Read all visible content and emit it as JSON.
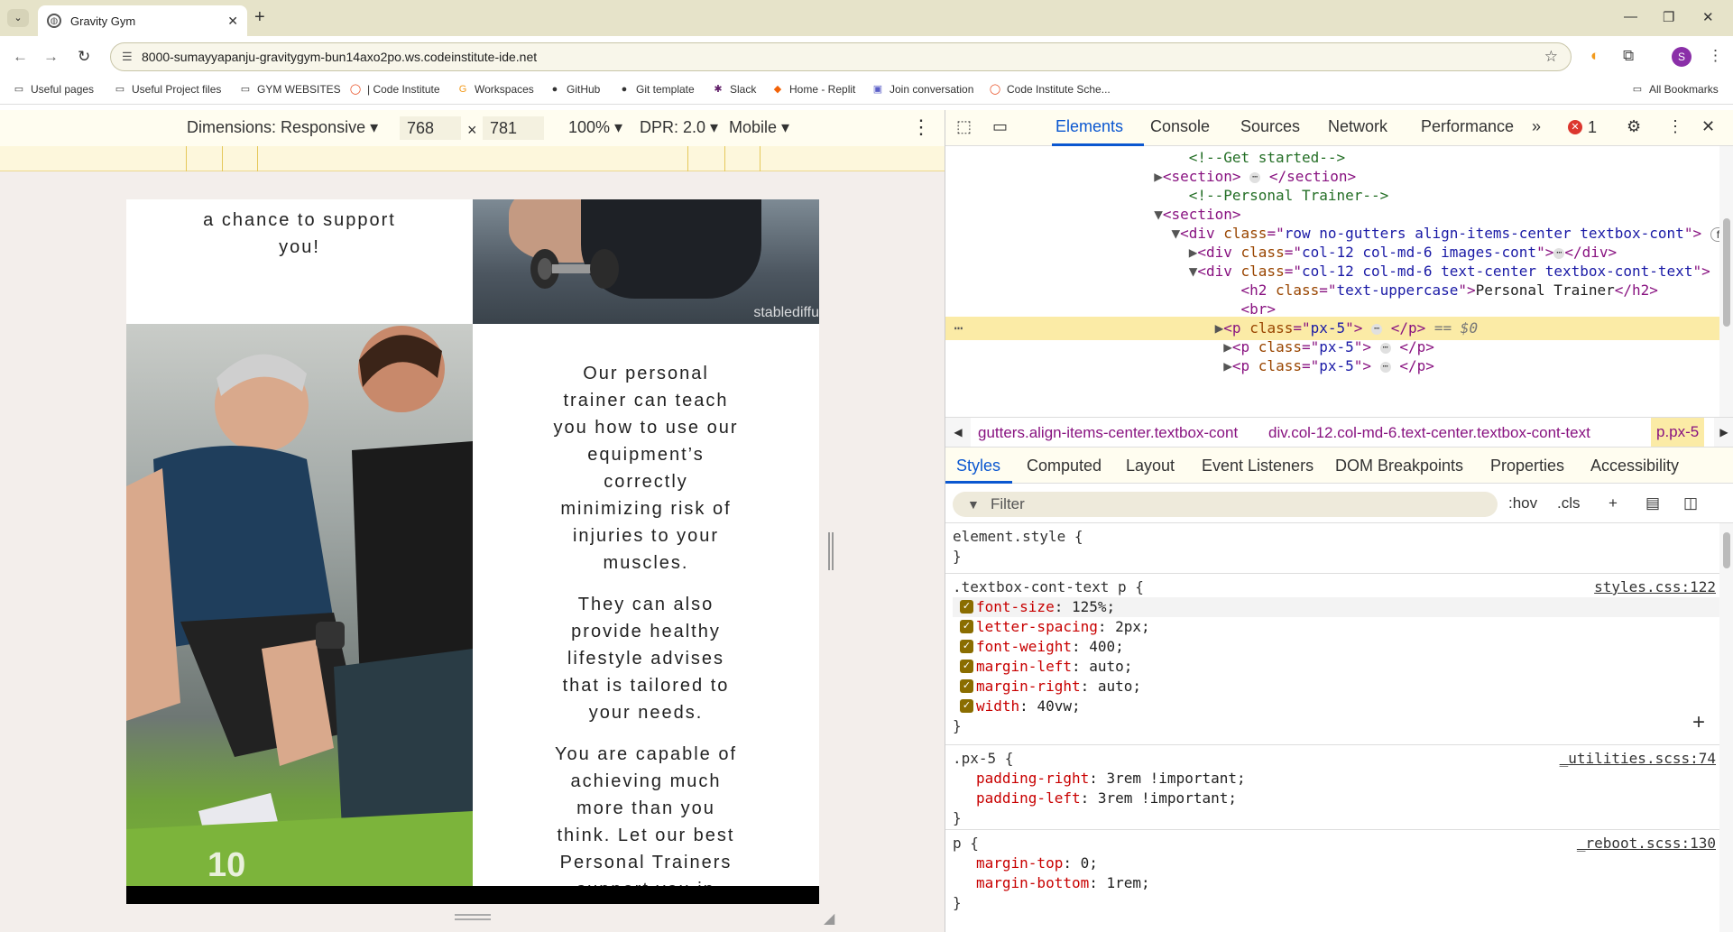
{
  "browser": {
    "tab_title": "Gravity Gym",
    "url": "8000-sumayyapanju-gravitygym-bun14axo2po.ws.codeinstitute-ide.net",
    "avatar_letter": "S",
    "bookmarks": [
      "Useful pages",
      "Useful Project files",
      "GYM WEBSITES",
      "| Code Institute",
      "Workspaces",
      "GitHub",
      "Git template",
      "Slack",
      "Home - Replit",
      "Join conversation",
      "Code Institute Sche..."
    ],
    "all_bookmarks": "All Bookmarks"
  },
  "device_toolbar": {
    "dimensions_label": "Dimensions: Responsive",
    "width": "768",
    "height": "781",
    "times": "×",
    "zoom": "100%",
    "dpr": "DPR: 2.0",
    "device_type": "Mobile"
  },
  "page": {
    "top_text_l1": "a chance to support",
    "top_text_l2": "you!",
    "watermark": "stablediffu",
    "para1": "Our personal trainer can teach you how to use our equipment’s correctly minimizing risk of injuries to your muscles.",
    "para2": "They can also provide healthy lifestyle advises that is tailored to your needs.",
    "para3": "You are capable of achieving much more than you think. Let our best Personal Trainers support you in this!"
  },
  "devtools": {
    "tabs": [
      "Elements",
      "Console",
      "Sources",
      "Network",
      "Performance"
    ],
    "more": "»",
    "error_count": "1",
    "breadcrumbs": [
      "gutters.align-items-center.textbox-cont",
      "div.col-12.col-md-6.text-center.textbox-cont-text",
      "p.px-5"
    ],
    "style_tabs": [
      "Styles",
      "Computed",
      "Layout",
      "Event Listeners",
      "DOM Breakpoints",
      "Properties",
      "Accessibility"
    ],
    "filter_placeholder": "Filter",
    "hov": ":hov",
    "cls": ".cls",
    "flex_badge": "flex",
    "selected_suffix": "== $0"
  },
  "styles": {
    "element_style": "element.style {",
    "rule1_selector": ".textbox-cont-text p {",
    "rule1_source": "styles.css:122",
    "rule1_props": [
      {
        "name": "font-size",
        "value": "125%;"
      },
      {
        "name": "letter-spacing",
        "value": "2px;"
      },
      {
        "name": "font-weight",
        "value": "400;"
      },
      {
        "name": "margin-left",
        "value": "auto;"
      },
      {
        "name": "margin-right",
        "value": "auto;"
      },
      {
        "name": "width",
        "value": "40vw;"
      }
    ],
    "rule2_selector": ".px-5 {",
    "rule2_source": "_utilities.scss:74",
    "rule2_props": [
      {
        "name": "padding-right",
        "value": "3rem !important;"
      },
      {
        "name": "padding-left",
        "value": "3rem !important;"
      }
    ],
    "rule3_selector": "p {",
    "rule3_source": "_reboot.scss:130",
    "rule3_props": [
      {
        "name": "margin-top",
        "value": "0;"
      },
      {
        "name": "margin-bottom",
        "value": "1rem;"
      }
    ],
    "close_brace": "}"
  }
}
